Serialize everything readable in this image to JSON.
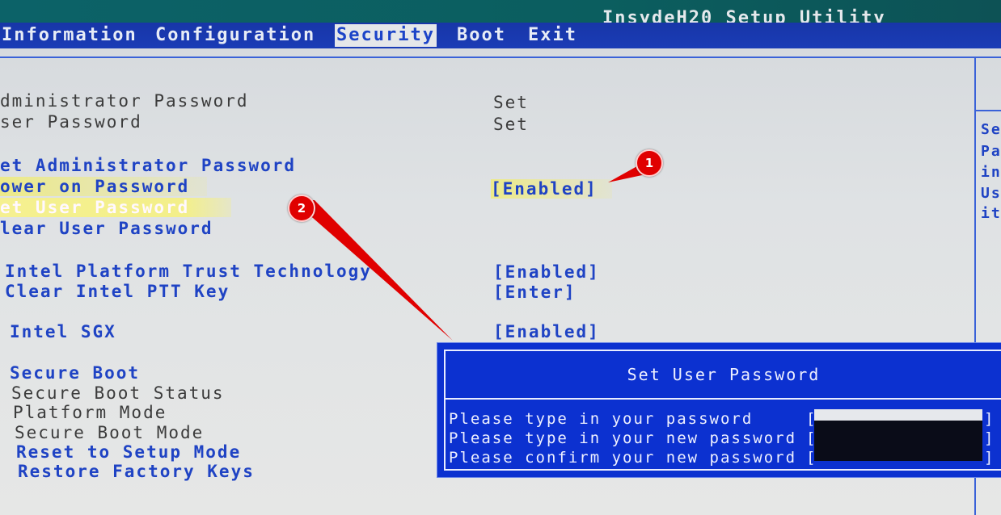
{
  "app_title": "InsydeH20 Setup Utility",
  "menu": {
    "items": [
      {
        "label": "Information",
        "active": false
      },
      {
        "label": "Configuration",
        "active": false
      },
      {
        "label": "Security",
        "active": true
      },
      {
        "label": "Boot",
        "active": false
      },
      {
        "label": "Exit",
        "active": false
      }
    ]
  },
  "rows": {
    "admin_password_label": "dministrator Password",
    "admin_password_value": "Set",
    "user_password_label": "ser Password",
    "user_password_value": "Set",
    "set_admin_password": "et Administrator Password",
    "power_on_password_label": "ower on Password",
    "power_on_password_value": "[Enabled]",
    "set_user_password": "et User Password",
    "clear_user_password": "lear User Password",
    "intel_ptt_label": "Intel Platform Trust Technology",
    "intel_ptt_value": "[Enabled]",
    "clear_ptt_label": "Clear Intel PTT Key",
    "clear_ptt_value": "[Enter]",
    "intel_sgx_label": "Intel SGX",
    "intel_sgx_value": "[Enabled]",
    "secure_boot": "Secure Boot",
    "secure_boot_status": "Secure Boot Status",
    "platform_mode": "Platform Mode",
    "secure_boot_mode": "Secure Boot Mode",
    "reset_setup_mode": "Reset to Setup Mode",
    "restore_factory_keys": "Restore Factory Keys"
  },
  "help_panel": {
    "lines": [
      "Se",
      "Pa",
      "in",
      "Us",
      "it"
    ]
  },
  "dialog": {
    "title": "Set User Password",
    "prompts": [
      {
        "label": "Please type in your password",
        "bracket_open": "[",
        "bracket_close": "]",
        "value": ""
      },
      {
        "label": "Please type in your new password",
        "bracket_open": "[",
        "bracket_close": "]",
        "value": ""
      },
      {
        "label": "Please confirm your new password",
        "bracket_open": "[",
        "bracket_close": "]",
        "value": ""
      }
    ]
  },
  "annotations": {
    "badge_1": "1",
    "badge_2": "2",
    "arrow_color": "#e00000"
  },
  "colors": {
    "menu_bar": "#1a3cb6",
    "option_blue": "#1f43c4",
    "dialog_bg": "#0c31d0",
    "highlight": "#f1ee8a"
  }
}
